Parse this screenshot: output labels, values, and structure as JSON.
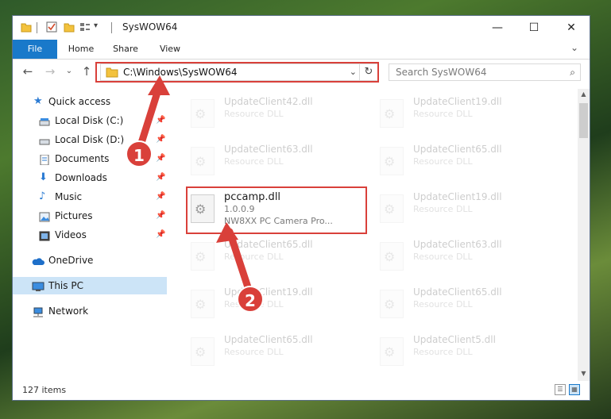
{
  "window": {
    "title": "SysWOW64",
    "minimize": "—",
    "maximize": "☐",
    "close": "✕"
  },
  "quick_access_toolbar": {
    "icons": [
      "folder-icon",
      "properties-icon",
      "new-folder-icon",
      "customize-icon"
    ],
    "dropdown": "▾"
  },
  "ribbon": {
    "tabs": [
      "File",
      "Home",
      "Share",
      "View"
    ],
    "expand": "⌄"
  },
  "nav": {
    "back": "←",
    "forward": "→",
    "recent": "⌄",
    "up": "↑"
  },
  "address": {
    "path": "C:\\Windows\\SysWOW64",
    "dropdown": "⌄",
    "refresh": "↻"
  },
  "search": {
    "placeholder": "Search SysWOW64",
    "icon": "⌕"
  },
  "sidebar": {
    "items": [
      {
        "label": "Quick access",
        "icon": "star-icon",
        "pinned": false
      },
      {
        "label": "Local Disk (C:)",
        "icon": "drive-icon",
        "pinned": true
      },
      {
        "label": "Local Disk (D:)",
        "icon": "drive-icon",
        "pinned": true
      },
      {
        "label": "Documents",
        "icon": "documents-icon",
        "pinned": true
      },
      {
        "label": "Downloads",
        "icon": "download-icon",
        "pinned": true
      },
      {
        "label": "Music",
        "icon": "music-icon",
        "pinned": true
      },
      {
        "label": "Pictures",
        "icon": "pictures-icon",
        "pinned": true
      },
      {
        "label": "Videos",
        "icon": "videos-icon",
        "pinned": true
      },
      {
        "label": "OneDrive",
        "icon": "cloud-icon",
        "pinned": false
      },
      {
        "label": "This PC",
        "icon": "computer-icon",
        "pinned": false,
        "selected": true
      },
      {
        "label": "Network",
        "icon": "network-icon",
        "pinned": false
      }
    ],
    "pin_glyph": "📌"
  },
  "files": {
    "left": [
      {
        "name": "UpdateClient42.dll",
        "type": "Resource DLL"
      },
      {
        "name": "UpdateClient63.dll",
        "type": "Resource DLL"
      },
      {
        "name": "pccamp.dll",
        "version": "1.0.0.9",
        "description": "NW8XX PC Camera Pro...",
        "highlighted": true
      },
      {
        "name": "UpdateClient65.dll",
        "type": "Resource DLL"
      },
      {
        "name": "UpdateClient19.dll",
        "type": "Resource DLL"
      },
      {
        "name": "UpdateClient65.dll",
        "type": "Resource DLL"
      }
    ],
    "right": [
      {
        "name": "UpdateClient19.dll",
        "type": "Resource DLL"
      },
      {
        "name": "UpdateClient65.dll",
        "type": "Resource DLL"
      },
      {
        "name": "UpdateClient19.dll",
        "type": "Resource DLL"
      },
      {
        "name": "UpdateClient63.dll",
        "type": "Resource DLL"
      },
      {
        "name": "UpdateClient65.dll",
        "type": "Resource DLL"
      },
      {
        "name": "UpdateClient5.dll",
        "type": "Resource DLL"
      }
    ]
  },
  "status": {
    "item_count": "127 items"
  },
  "annotations": {
    "step1": "1",
    "step2": "2",
    "color": "#d9403a"
  }
}
